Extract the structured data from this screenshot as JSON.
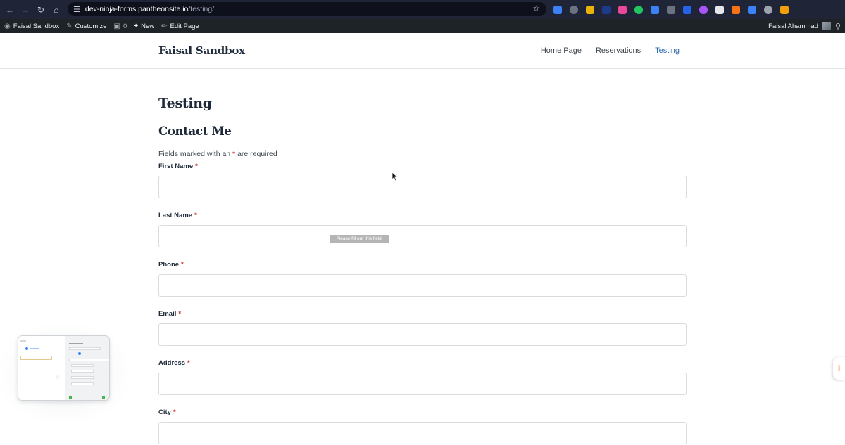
{
  "browser": {
    "url_host": "dev-ninja-forms.pantheonsite.io",
    "url_path": "/testing/",
    "nav_back_icon": "back-arrow-icon",
    "nav_forward_icon": "forward-arrow-icon",
    "reload_icon": "reload-icon",
    "home_icon": "home-icon",
    "bookmark_icon": "star-icon",
    "extension_colors": [
      "#3b82f6",
      "#6b7280",
      "#eab308",
      "#1e3a8a",
      "#ec4899",
      "#22c55e",
      "#3b82f6",
      "#6b7280",
      "#2563eb",
      "#a855f7",
      "#e5e7eb",
      "#f97316",
      "#3b82f6",
      "#9ca3af",
      "#f59e0b"
    ]
  },
  "admin_bar": {
    "site_name": "Faisal Sandbox",
    "customize": "Customize",
    "comments_count": "0",
    "new": "New",
    "edit_page": "Edit Page",
    "user_name": "Faisal Ahammad"
  },
  "site": {
    "title": "Faisal Sandbox",
    "nav": [
      "Home Page",
      "Reservations",
      "Testing"
    ],
    "active_nav": "Testing"
  },
  "page": {
    "title": "Testing",
    "form_title": "Contact Me",
    "required_note_before": "Fields marked with an",
    "required_star": "*",
    "required_note_after": "are required"
  },
  "form": {
    "fields": [
      {
        "label": "First Name",
        "required_mark": "*",
        "value": ""
      },
      {
        "label": "Last Name",
        "required_mark": "*",
        "value": ""
      },
      {
        "label": "Phone",
        "required_mark": "*",
        "value": ""
      },
      {
        "label": "Email",
        "required_mark": "*",
        "value": ""
      },
      {
        "label": "Address",
        "required_mark": "*",
        "value": ""
      },
      {
        "label": "City",
        "required_mark": "*",
        "value": ""
      }
    ],
    "validation_tooltip": "Please fill out this field."
  },
  "colors": {
    "accent_link": "#2b6cb0",
    "required_star": "#cc1818",
    "admin_bar_bg": "#1d2327",
    "browser_bar_bg": "#1f2437",
    "side_tab_accent": "#f08a24"
  }
}
